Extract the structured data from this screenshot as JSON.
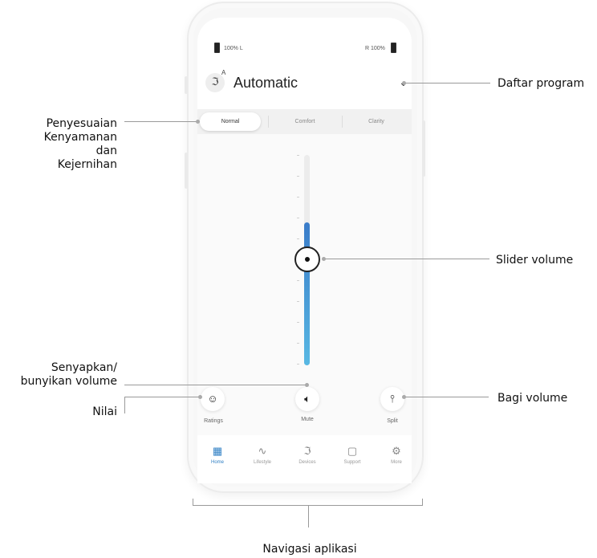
{
  "status": {
    "battery_left": "100% L",
    "battery_right": "R 100%"
  },
  "program": {
    "icon_letter": "A",
    "name": "Automatic",
    "dropdown_glyph": "⌄"
  },
  "tabs": [
    {
      "label": "Normal",
      "active": true
    },
    {
      "label": "Comfort",
      "active": false
    },
    {
      "label": "Clarity",
      "active": false
    }
  ],
  "volume": {
    "level_fraction": 0.45,
    "fill_color_top": "#3a7cc9",
    "fill_color_bottom": "#58b8e3"
  },
  "actions": {
    "ratings": {
      "label": "Ratings",
      "icon": "smiley-icon"
    },
    "mute": {
      "label": "Mute",
      "icon": "speaker-icon"
    },
    "split": {
      "label": "Split",
      "icon": "split-sliders-icon"
    }
  },
  "nav": [
    {
      "label": "Home",
      "icon": "grid-icon",
      "glyph": "▦",
      "active": true
    },
    {
      "label": "Lifestyle",
      "icon": "activity-icon",
      "glyph": "∿",
      "active": false
    },
    {
      "label": "Devices",
      "icon": "hearing-aid-icon",
      "glyph": "ℑ",
      "active": false
    },
    {
      "label": "Support",
      "icon": "chat-icon",
      "glyph": "▢",
      "active": false
    },
    {
      "label": "More",
      "icon": "gear-icon",
      "glyph": "⚙",
      "active": false
    }
  ],
  "callouts": {
    "program_list": "Daftar program",
    "comfort_clarity_line1": "Penyesuaian",
    "comfort_clarity_line2": "Kenyamanan dan",
    "comfort_clarity_line3": "Kejernihan",
    "volume_slider": "Slider volume",
    "mute_line1": "Senyapkan/",
    "mute_line2": "bunyikan volume",
    "ratings": "Nilai",
    "split_volume": "Bagi volume",
    "app_navigation": "Navigasi aplikasi"
  },
  "accent_color": "#2f7fc4"
}
